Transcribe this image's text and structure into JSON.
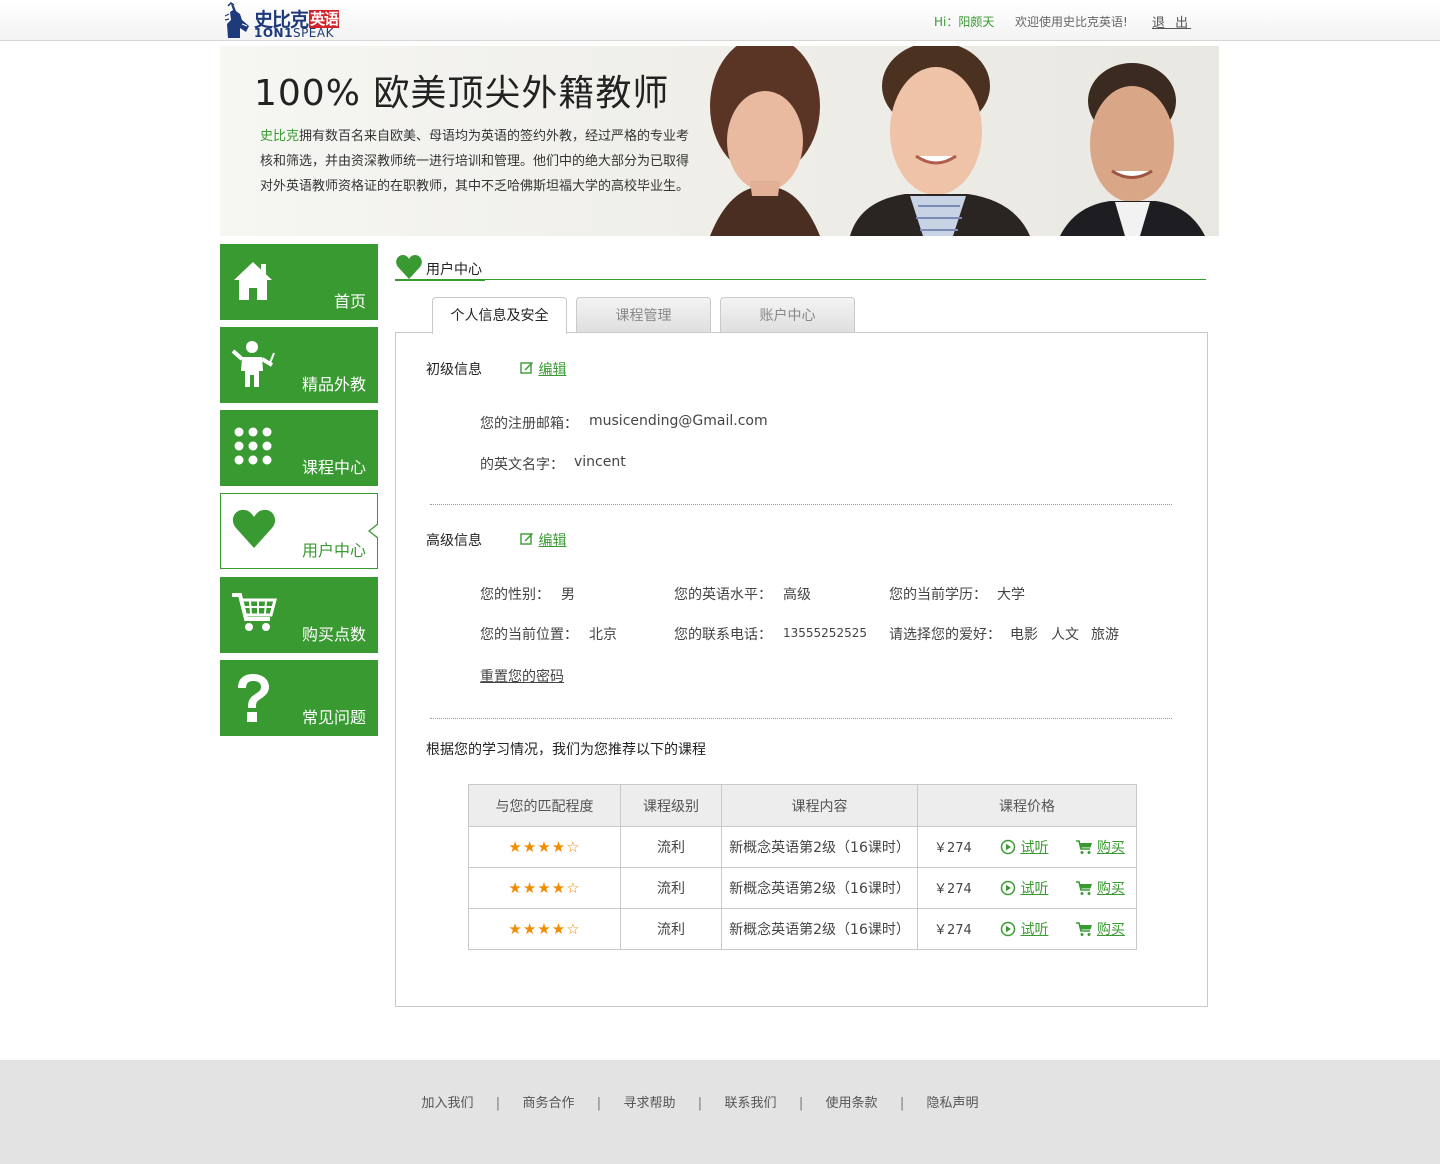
{
  "header": {
    "logo_cn": "史比克",
    "logo_cn_tag": "英语",
    "logo_en_bold": "1ON1",
    "logo_en_rest": "SPEAK",
    "greeting": "Hi：阳颇天",
    "welcome": "欢迎使用史比克英语!",
    "logout": "退 出"
  },
  "banner": {
    "headline": "100% 欧美顶尖外籍教师",
    "brand": "史比克",
    "description": "拥有数百名来自欧美、母语均为英语的签约外教，经过严格的专业考核和筛选，并由资深教师统一进行培训和管理。他们中的绝大部分为已取得对外英语教师资格证的在职教师，其中不乏哈佛斯坦福大学的高校毕业生。"
  },
  "sidebar": {
    "items": [
      {
        "label": "首页",
        "icon": "home-icon"
      },
      {
        "label": "精品外教",
        "icon": "teacher-icon"
      },
      {
        "label": "课程中心",
        "icon": "grid-dots-icon"
      },
      {
        "label": "用户中心",
        "icon": "heart-icon",
        "active": true
      },
      {
        "label": "购买点数",
        "icon": "cart-icon"
      },
      {
        "label": "常见问题",
        "icon": "question-icon"
      }
    ]
  },
  "page": {
    "title": "用户中心",
    "tabs": [
      {
        "label": "个人信息及安全",
        "active": true
      },
      {
        "label": "课程管理"
      },
      {
        "label": "账户中心"
      }
    ]
  },
  "basic": {
    "title": "初级信息",
    "edit": "编辑",
    "email_label": "您的注册邮箱：",
    "email_value": "musicending@Gmail.com",
    "name_label": "的英文名字：",
    "name_value": "vincent"
  },
  "advanced": {
    "title": "高级信息",
    "edit": "编辑",
    "gender_label": "您的性别：",
    "gender_value": "男",
    "level_label": "您的英语水平：",
    "level_value": "高级",
    "edu_label": "您的当前学历：",
    "edu_value": "大学",
    "location_label": "您的当前位置：",
    "location_value": "北京",
    "phone_label": "您的联系电话：",
    "phone_value": "13555252525",
    "hobby_label": "请选择您的爱好：",
    "hobbies": [
      "电影",
      "人文",
      "旅游"
    ],
    "reset_password": "重置您的密码"
  },
  "recommend": {
    "intro": "根据您的学习情况，我们为您推荐以下的课程",
    "headers": [
      "与您的匹配程度",
      "课程级别",
      "课程内容",
      "课程价格"
    ],
    "rows": [
      {
        "stars": "★★★★☆",
        "rating": 4,
        "level": "流利",
        "content": "新概念英语第2级（16课时）",
        "price": "￥274",
        "listen": "试听",
        "buy": "购买"
      },
      {
        "stars": "★★★★☆",
        "rating": 4,
        "level": "流利",
        "content": "新概念英语第2级（16课时）",
        "price": "￥274",
        "listen": "试听",
        "buy": "购买"
      },
      {
        "stars": "★★★★☆",
        "rating": 4,
        "level": "流利",
        "content": "新概念英语第2级（16课时）",
        "price": "￥274",
        "listen": "试听",
        "buy": "购买"
      }
    ]
  },
  "footer": {
    "links": [
      "加入我们",
      "商务合作",
      "寻求帮助",
      "联系我们",
      "使用条款",
      "隐私声明"
    ],
    "separator": "|"
  },
  "colors": {
    "brand_green": "#3a9a32",
    "star_orange": "#f08c00",
    "logo_blue": "#1f3a7a",
    "logo_red": "#d4232b"
  }
}
